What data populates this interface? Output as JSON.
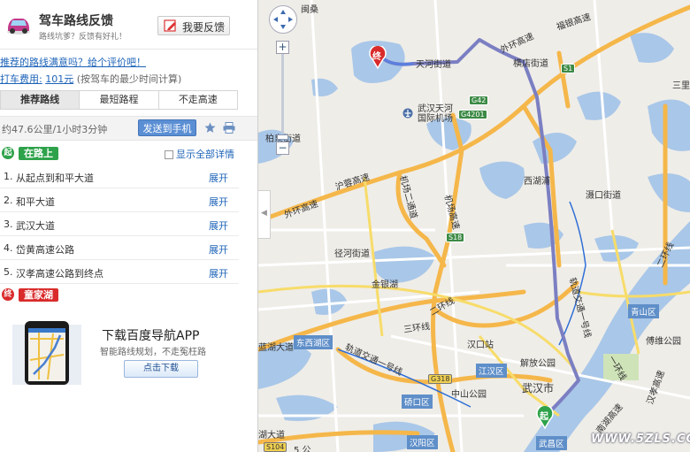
{
  "feedback": {
    "title": "驾车路线反馈",
    "subtitle": "路线坑爹？反馈有好礼！",
    "button": "我要反馈"
  },
  "links": {
    "rate": "推荐的路线满意吗？给个评价吧！",
    "taxi_label": "打车费用:",
    "taxi_value": "101元",
    "taxi_note": "(按驾车的最少时间计算)"
  },
  "tabs": [
    "推荐路线",
    "最短路程",
    "不走高速"
  ],
  "summary": {
    "text": "约47.6公里/1小时3分钟",
    "send_button": "发送到手机"
  },
  "start": {
    "badge": "起",
    "label": "在路上"
  },
  "show_all": "显示全部详情",
  "steps": [
    {
      "num": "1.",
      "name": "从起点到和平大道",
      "expand": "展开"
    },
    {
      "num": "2.",
      "name": "和平大道",
      "expand": "展开"
    },
    {
      "num": "3.",
      "name": "武汉大道",
      "expand": "展开"
    },
    {
      "num": "4.",
      "name": "岱黄高速公路",
      "expand": "展开"
    },
    {
      "num": "5.",
      "name": "汉孝高速公路到终点",
      "expand": "展开"
    }
  ],
  "end": {
    "badge": "终",
    "label": "童家湖"
  },
  "app": {
    "title": "下载百度导航APP",
    "subtitle": "智能路线规划，不走冤枉路",
    "button": "点击下载"
  },
  "colors": {
    "start_green": "#2ea24a",
    "end_red": "#d92b2b",
    "link_blue": "#1d63b8",
    "route_purple": "#7b7fc2"
  },
  "map": {
    "markers": {
      "start": "起",
      "end": "终"
    },
    "places": {
      "fenghuang": "闽桑",
      "tianhe": "天河街道",
      "hengdian": "横店街道",
      "airport": "武汉天河\n国际机场",
      "baiquan": "柏泉街道",
      "hurenjie": "三里",
      "xihu": "西湖浦",
      "jingkou": "滠口街道",
      "jinghe": "径河街道",
      "jinyin": "金银湖",
      "qingshan": "青山区",
      "dongxihu": "东西湖区",
      "hankou": "汉口站",
      "jianghan": "江汉区",
      "jiefang": "解放公园",
      "zhongshan": "中山公园",
      "wuhanshi": "武汉市",
      "qiaokou": "硚口区",
      "hanyang": "汉阳区",
      "wuchang": "武昌区",
      "yuandian": "傅维公园",
      "gongpu": "5 公",
      "hubo": "湖大道"
    },
    "roads": {
      "waihuan_n": "外环高速",
      "hurong": "沪蓉高速",
      "jichang1": "机场二通道",
      "jichang2": "机场高速",
      "waihuan_w": "外环高速",
      "fuqian": "福银高速",
      "sanhuan": "三环线",
      "erhuan": "二环线",
      "qingnian": "蓝湖大道",
      "guidao": "轨道交通一号线",
      "guidao2": "轨道交通一号线",
      "yihuan": "一环线",
      "erhuan2": "二环线",
      "hanxiao": "汉孝高速",
      "nanhu": "南湖高速"
    },
    "shields": {
      "G42": "G42",
      "G4201": "G4201",
      "S1": "S1",
      "S18": "S18",
      "G318": "G318",
      "S104": "S104"
    },
    "watermark": "WWW.5ZLS.COM"
  }
}
